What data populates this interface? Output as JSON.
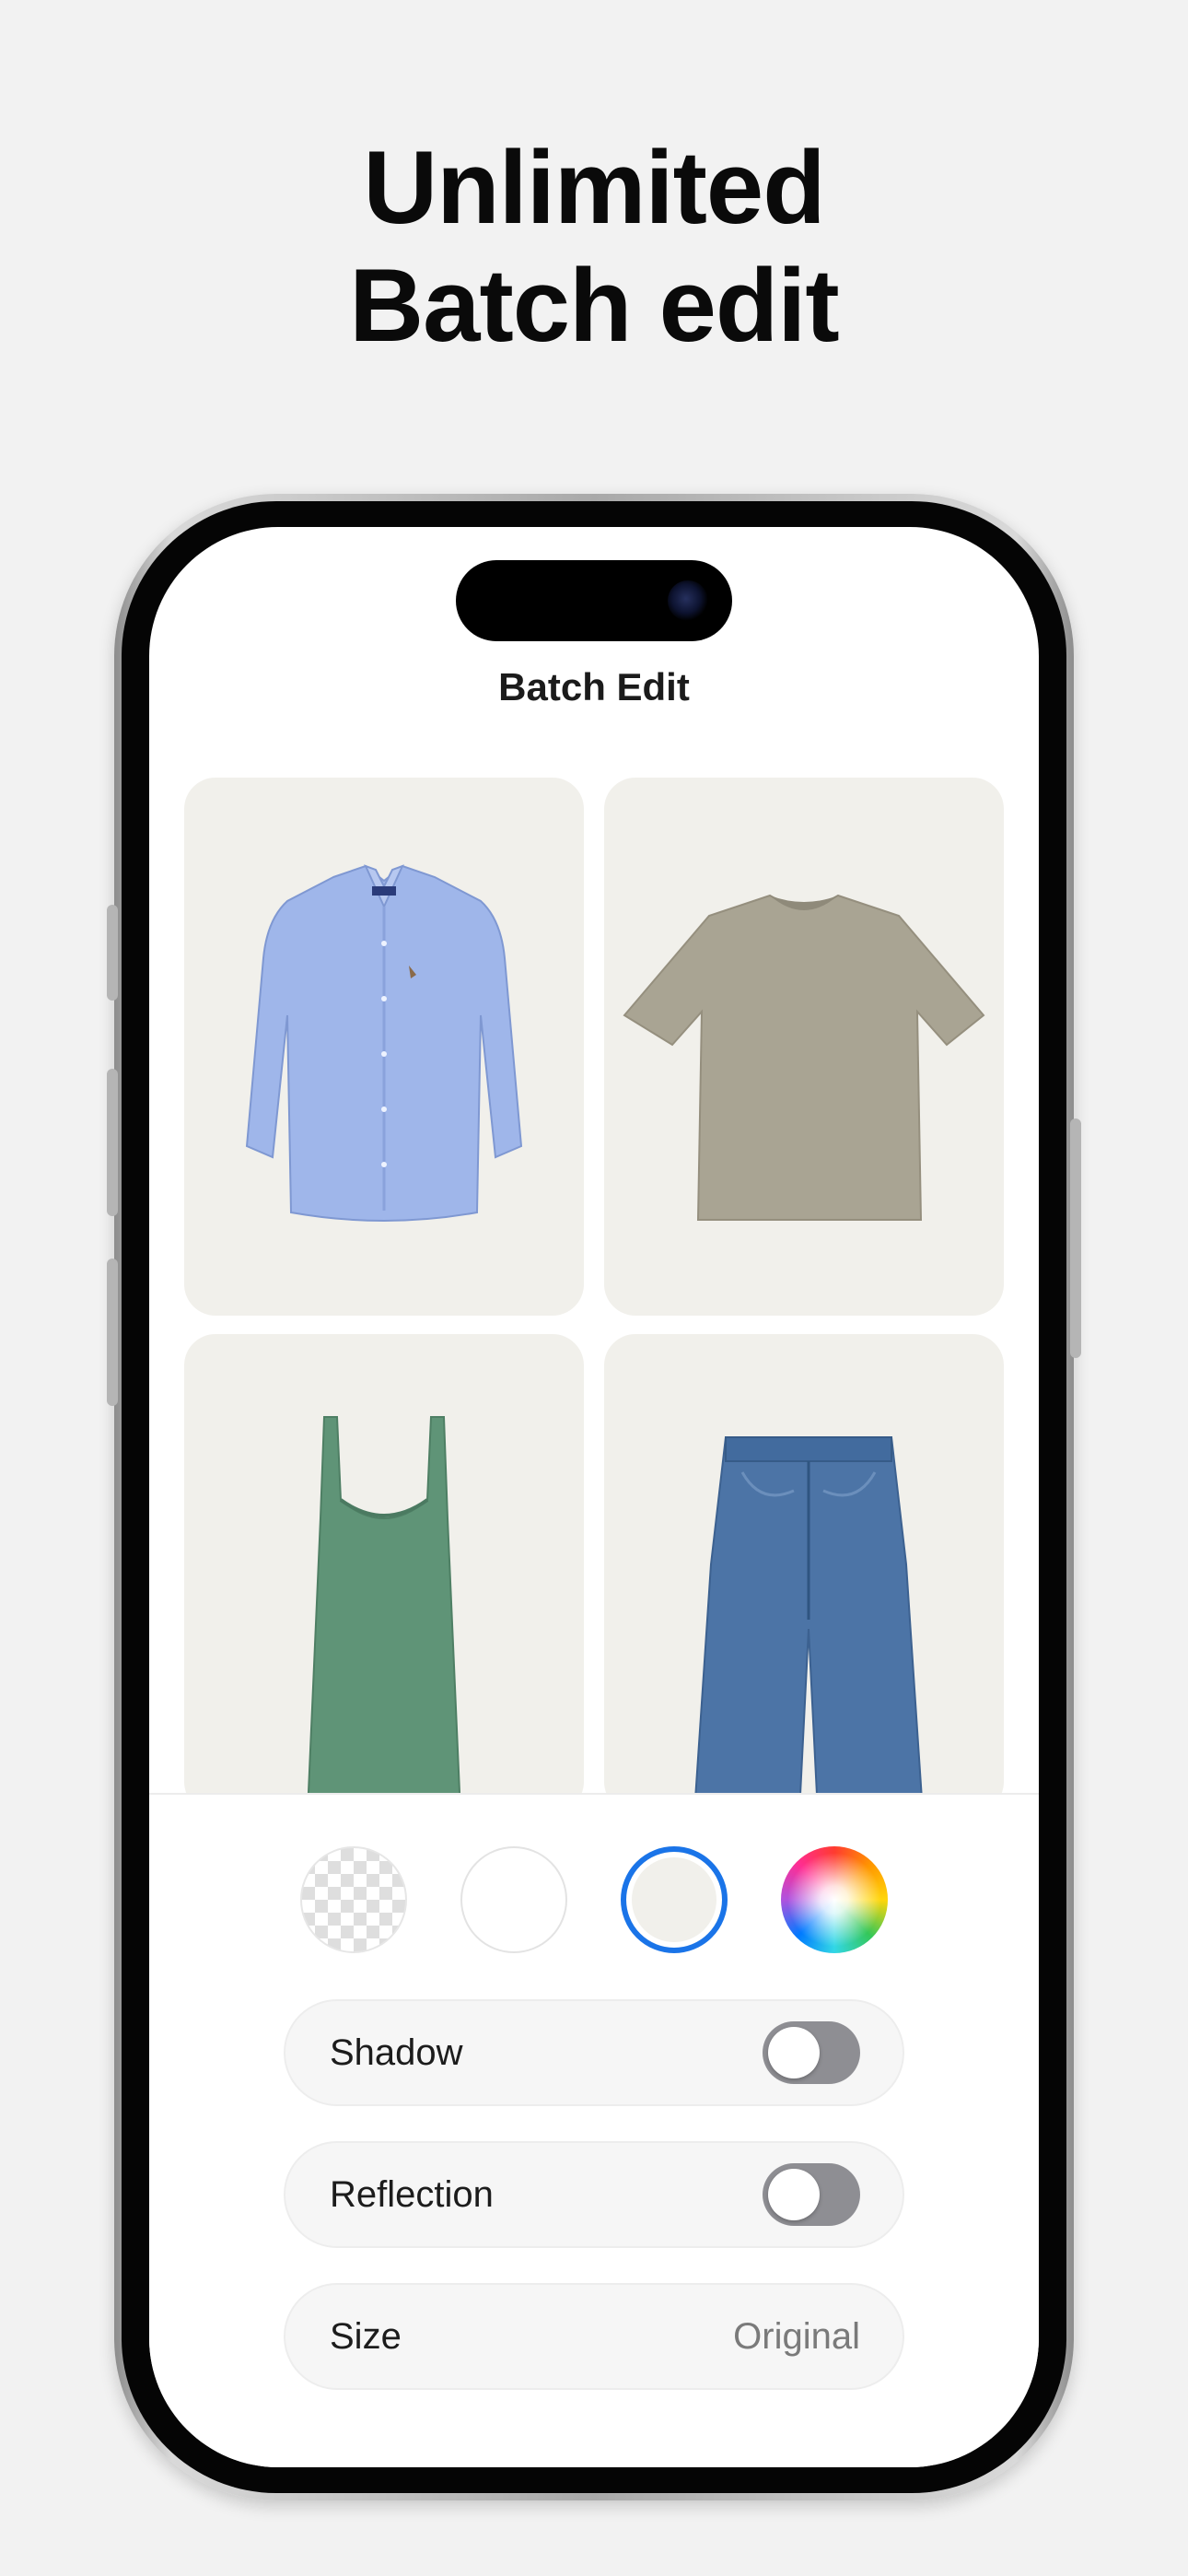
{
  "headline": {
    "line1": "Unlimited",
    "line2": "Batch edit"
  },
  "nav": {
    "title": "Batch Edit"
  },
  "grid": {
    "items": [
      {
        "name": "blue-oxford-shirt"
      },
      {
        "name": "khaki-tshirt"
      },
      {
        "name": "green-tank-dress"
      },
      {
        "name": "blue-wide-jeans"
      }
    ]
  },
  "backgrounds": {
    "options": [
      "transparent",
      "white",
      "cream",
      "custom-color"
    ],
    "selected": "cream",
    "colors": {
      "white": "#ffffff",
      "cream": "#f1f0eb",
      "selection_ring": "#1a74e8"
    }
  },
  "settings": {
    "shadow": {
      "label": "Shadow",
      "enabled": false
    },
    "reflection": {
      "label": "Reflection",
      "enabled": false
    },
    "size": {
      "label": "Size",
      "value": "Original"
    }
  }
}
